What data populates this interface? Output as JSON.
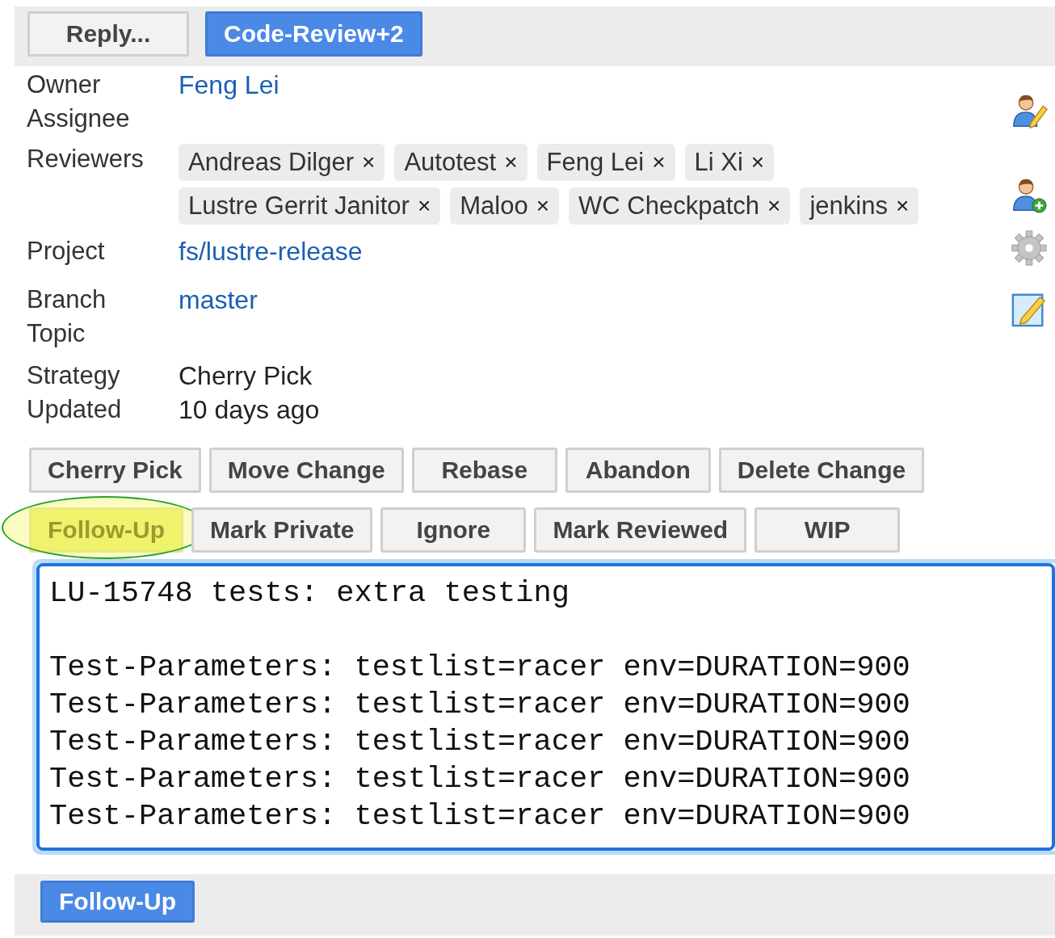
{
  "top_actions": [
    {
      "label": "Reply...",
      "kind": "plain"
    },
    {
      "label": "Code-Review+2",
      "kind": "primary"
    }
  ],
  "fields": [
    {
      "label": "Owner",
      "kind": "link",
      "value": "Feng Lei"
    },
    {
      "label": "Assignee",
      "kind": "text"
    },
    {
      "label": "Reviewers",
      "kind": "reviewers",
      "reviewers": [
        "Andreas Dilger",
        "Autotest",
        "Feng Lei",
        "Li Xi",
        "Lustre Gerrit Janitor",
        "Maloo",
        "WC Checkpatch",
        "jenkins"
      ],
      "remove_glyph": "×"
    },
    {
      "label": "Project",
      "kind": "link",
      "value": "fs/lustre-release"
    },
    {
      "label": "Branch",
      "kind": "link",
      "value": "master"
    },
    {
      "label": "Topic",
      "kind": "text"
    },
    {
      "label": "Strategy",
      "kind": "text",
      "value": "Cherry Pick"
    },
    {
      "label": "Updated",
      "kind": "text",
      "value": "10 days ago"
    }
  ],
  "action_rows": [
    [
      {
        "label": "Cherry Pick",
        "highlighted": false
      },
      {
        "label": "Move Change",
        "highlighted": false
      },
      {
        "label": "Rebase",
        "highlighted": false
      },
      {
        "label": "Abandon",
        "highlighted": false
      },
      {
        "label": "Delete Change",
        "highlighted": false
      }
    ],
    [
      {
        "label": "Follow-Up",
        "highlighted": true
      },
      {
        "label": "Mark Private",
        "highlighted": false
      },
      {
        "label": "Ignore",
        "highlighted": false
      },
      {
        "label": "Mark Reviewed",
        "highlighted": false
      },
      {
        "label": "WIP",
        "highlighted": false
      }
    ]
  ],
  "follow_up_dialog": {
    "subject": "LU-15748 tests: extra testing",
    "body_lines": [
      "Test-Parameters: testlist=racer env=DURATION=900",
      "Test-Parameters: testlist=racer env=DURATION=900",
      "Test-Parameters: testlist=racer env=DURATION=900",
      "Test-Parameters: testlist=racer env=DURATION=900",
      "Test-Parameters: testlist=racer env=DURATION=900"
    ],
    "submit_label": "Follow-Up"
  }
}
